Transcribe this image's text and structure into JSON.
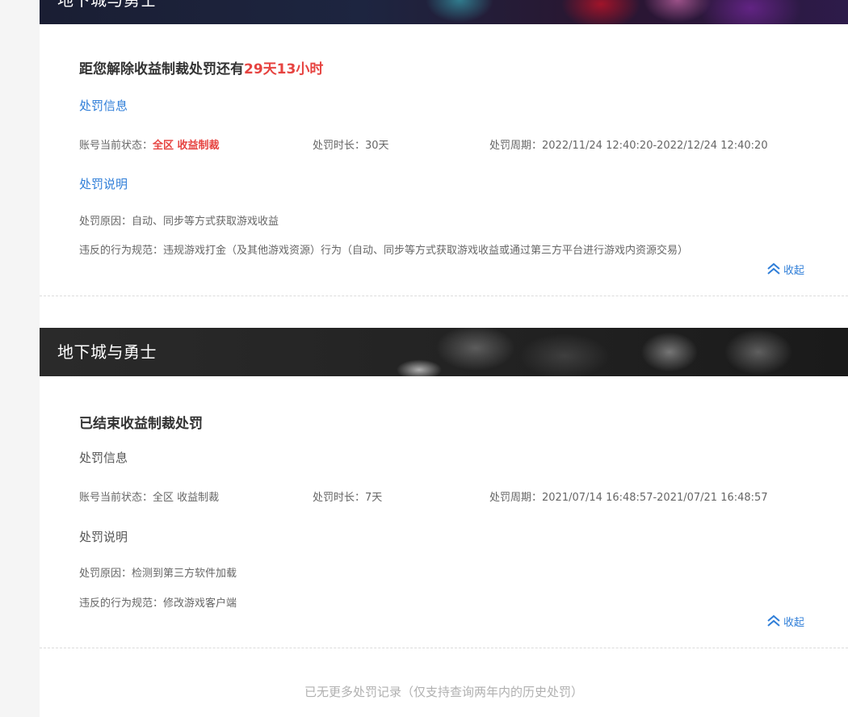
{
  "records": [
    {
      "game_title": "地下城与勇士",
      "headline_prefix": "距您解除收益制裁处罚还有",
      "headline_highlight": "29天13小时",
      "info_title": "处罚信息",
      "status_label": "账号当前状态：",
      "status_value": "全区 收益制裁",
      "duration_label": "处罚时长：",
      "duration_value": "30天",
      "period_label": "处罚周期：",
      "period_value": "2022/11/24 12:40:20-2022/12/24 12:40:20",
      "desc_title": "处罚说明",
      "reason_label": "处罚原因：",
      "reason_value": "自动、同步等方式获取游戏收益",
      "violation_label": "违反的行为规范：",
      "violation_value": "违规游戏打金（及其他游戏资源）行为（自动、同步等方式获取游戏收益或通过第三方平台进行游戏内资源交易）",
      "collapse_label": "收起"
    },
    {
      "game_title": "地下城与勇士",
      "headline_prefix": "已结束收益制裁处罚",
      "headline_highlight": "",
      "info_title": "处罚信息",
      "status_label": "账号当前状态：",
      "status_value": "全区 收益制裁",
      "duration_label": "处罚时长：",
      "duration_value": "7天",
      "period_label": "处罚周期：",
      "period_value": "2021/07/14 16:48:57-2021/07/21 16:48:57",
      "desc_title": "处罚说明",
      "reason_label": "处罚原因：",
      "reason_value": "检测到第三方软件加载",
      "violation_label": "违反的行为规范：",
      "violation_value": "修改游戏客户端",
      "collapse_label": "收起"
    }
  ],
  "footer_note": "已无更多处罚记录（仅支持查询两年内的历史处罚）",
  "colors": {
    "accent_blue": "#2f7ed8",
    "alert_red": "#e64340",
    "page_bg": "#f5f5f5"
  },
  "icons": {
    "collapse": "double-chevron-up-icon"
  }
}
